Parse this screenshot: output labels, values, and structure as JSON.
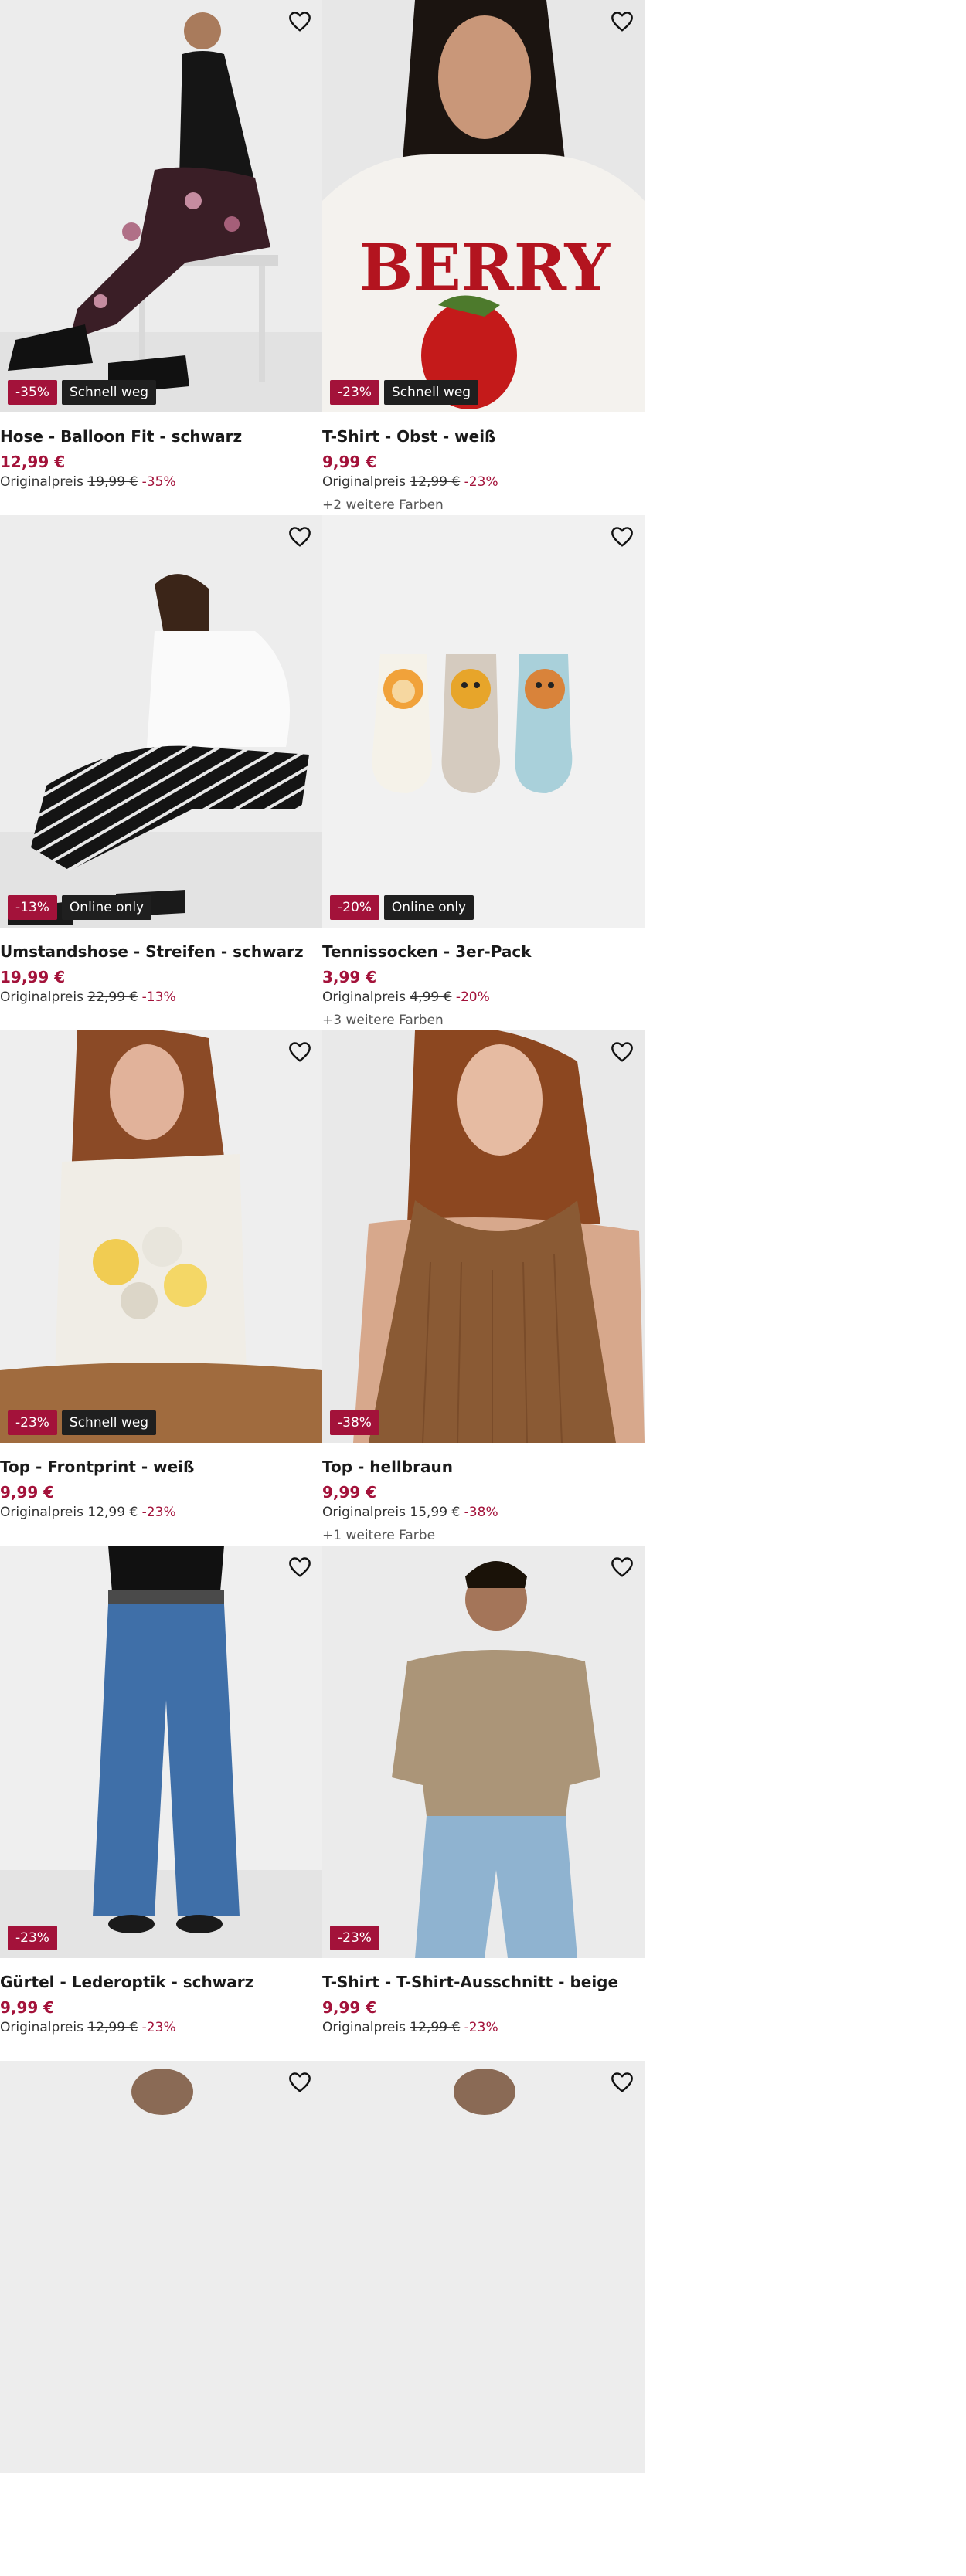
{
  "colors": {
    "sale": "#a3123a",
    "flag": "#1f1f1f"
  },
  "product_labels": {
    "original_price_prefix": "Originalpreis"
  },
  "products": [
    {
      "name": "Hose - Balloon Fit - schwarz",
      "price": "12,99 €",
      "original": "19,99 €",
      "discount": "-35%",
      "badges": [
        "-35%",
        "Schnell weg"
      ],
      "more_colors": "",
      "image": "woman-black-floral-pants"
    },
    {
      "name": "T-Shirt - Obst - weiß",
      "price": "9,99 €",
      "original": "12,99 €",
      "discount": "-23%",
      "badges": [
        "-23%",
        "Schnell weg"
      ],
      "more_colors": "+2 weitere Farben",
      "image": "berry-tshirt"
    },
    {
      "name": "Umstandshose - Streifen - schwarz",
      "price": "19,99 €",
      "original": "22,99 €",
      "discount": "-13%",
      "badges": [
        "-13%",
        "Online only"
      ],
      "more_colors": "",
      "image": "striped-maternity-pants"
    },
    {
      "name": "Tennissocken - 3er-Pack",
      "price": "3,99 €",
      "original": "4,99 €",
      "discount": "-20%",
      "badges": [
        "-20%",
        "Online only"
      ],
      "more_colors": "+3 weitere Farben",
      "image": "kids-animal-socks"
    },
    {
      "name": "Top - Frontprint - weiß",
      "price": "9,99 €",
      "original": "12,99 €",
      "discount": "-23%",
      "badges": [
        "-23%",
        "Schnell weg"
      ],
      "more_colors": "",
      "image": "floral-print-top"
    },
    {
      "name": "Top - hellbraun",
      "price": "9,99 €",
      "original": "15,99 €",
      "discount": "-38%",
      "badges": [
        "-38%"
      ],
      "more_colors": "+1 weitere Farbe",
      "image": "brown-tank-top"
    },
    {
      "name": "Gürtel - Lederoptik - schwarz",
      "price": "9,99 €",
      "original": "12,99 €",
      "discount": "-23%",
      "badges": [
        "-23%"
      ],
      "more_colors": "",
      "image": "jeans-with-belt"
    },
    {
      "name": "T-Shirt - T-Shirt-Ausschnitt - beige",
      "price": "9,99 €",
      "original": "12,99 €",
      "discount": "-23%",
      "badges": [
        "-23%"
      ],
      "more_colors": "",
      "image": "man-beige-tshirt"
    },
    {
      "name": "",
      "price": "",
      "original": "",
      "discount": "",
      "badges": [],
      "more_colors": "",
      "image": "partial-next-row"
    },
    {
      "name": "",
      "price": "",
      "original": "",
      "discount": "",
      "badges": [],
      "more_colors": "",
      "image": "partial-next-row"
    }
  ]
}
